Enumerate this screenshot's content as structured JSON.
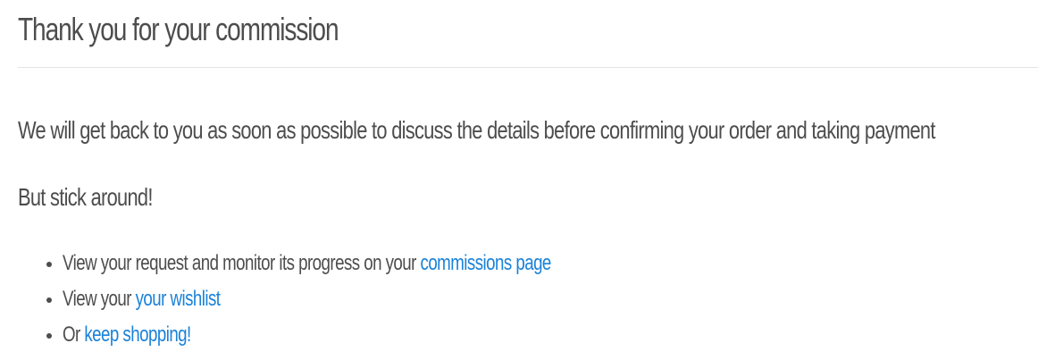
{
  "title": "Thank you for your commission",
  "message": "We will get back to you as soon as possible to discuss the details before confirming your order and taking payment",
  "sub_message": "But stick around!",
  "links": [
    {
      "prefix": "View your request and monitor its progress on your ",
      "link_text": "commissions page"
    },
    {
      "prefix": "View your ",
      "link_text": "your wishlist"
    },
    {
      "prefix": "Or ",
      "link_text": "keep shopping!"
    }
  ],
  "colors": {
    "text": "#4d4d4d",
    "link": "#1a82d8",
    "divider": "#e4e4e4"
  }
}
